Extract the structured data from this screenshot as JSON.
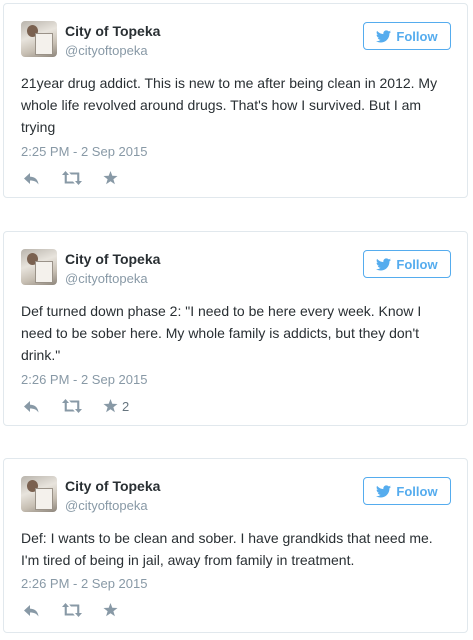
{
  "icons": {
    "follow": "twitter-bird-icon",
    "reply": "reply-arrow-icon",
    "retweet": "retweet-icon",
    "favorite": "star-icon"
  },
  "colors": {
    "accent": "#55acee",
    "text": "#292f33",
    "muted": "#8899a6",
    "border": "#e1e8ed"
  },
  "tweets": [
    {
      "name": "City of Topeka",
      "handle": "@cityoftopeka",
      "follow_label": "Follow",
      "text": "21year drug addict. This is new to me after being clean in 2012. My whole life revolved around drugs. That's how I survived. But I am trying",
      "time": "2:25 PM - 2 Sep 2015",
      "favorites": ""
    },
    {
      "name": "City of Topeka",
      "handle": "@cityoftopeka",
      "follow_label": "Follow",
      "text": "Def turned down phase 2: \"I need to be here every week. Know I need to be sober here. My whole family is addicts, but they don't drink.\"",
      "time": "2:26 PM - 2 Sep 2015",
      "favorites": "2"
    },
    {
      "name": "City of Topeka",
      "handle": "@cityoftopeka",
      "follow_label": "Follow",
      "text": "Def: I wants to be clean and sober. I have grandkids that need me. I'm tired of being in jail, away from family in treatment.",
      "time": "2:26 PM - 2 Sep 2015",
      "favorites": ""
    }
  ]
}
